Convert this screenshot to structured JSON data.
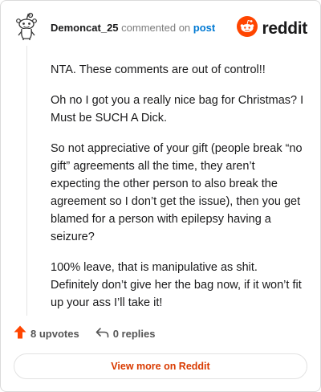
{
  "comment": {
    "username": "Demoncat_25",
    "action_text": " commented on ",
    "post_link_text": "post",
    "body": [
      "NTA. These comments are out of control!!",
      "Oh no I got you a really nice bag for Christmas? I Must be SUCH A Dick.",
      "So not appreciative of your gift (people break “no gift” agreements all the time, they aren’t expecting the other person to also break the agreement so I don’t get the issue), then you get blamed for a person with epilepsy having a seizure?",
      "100% leave, that is manipulative as shit. Definitely don’t give her the bag now, if it won’t fit up your ass I’ll take it!"
    ],
    "upvotes": "8 upvotes",
    "replies": "0 replies"
  },
  "brand": {
    "name": "reddit",
    "accent_color": "#ff4500"
  },
  "footer": {
    "view_more_label": "View more on Reddit"
  },
  "icons": {
    "avatar": "snoo-avatar-icon",
    "logo": "reddit-logo-icon",
    "upvote": "upvote-arrow-icon",
    "reply": "reply-arrow-icon"
  }
}
